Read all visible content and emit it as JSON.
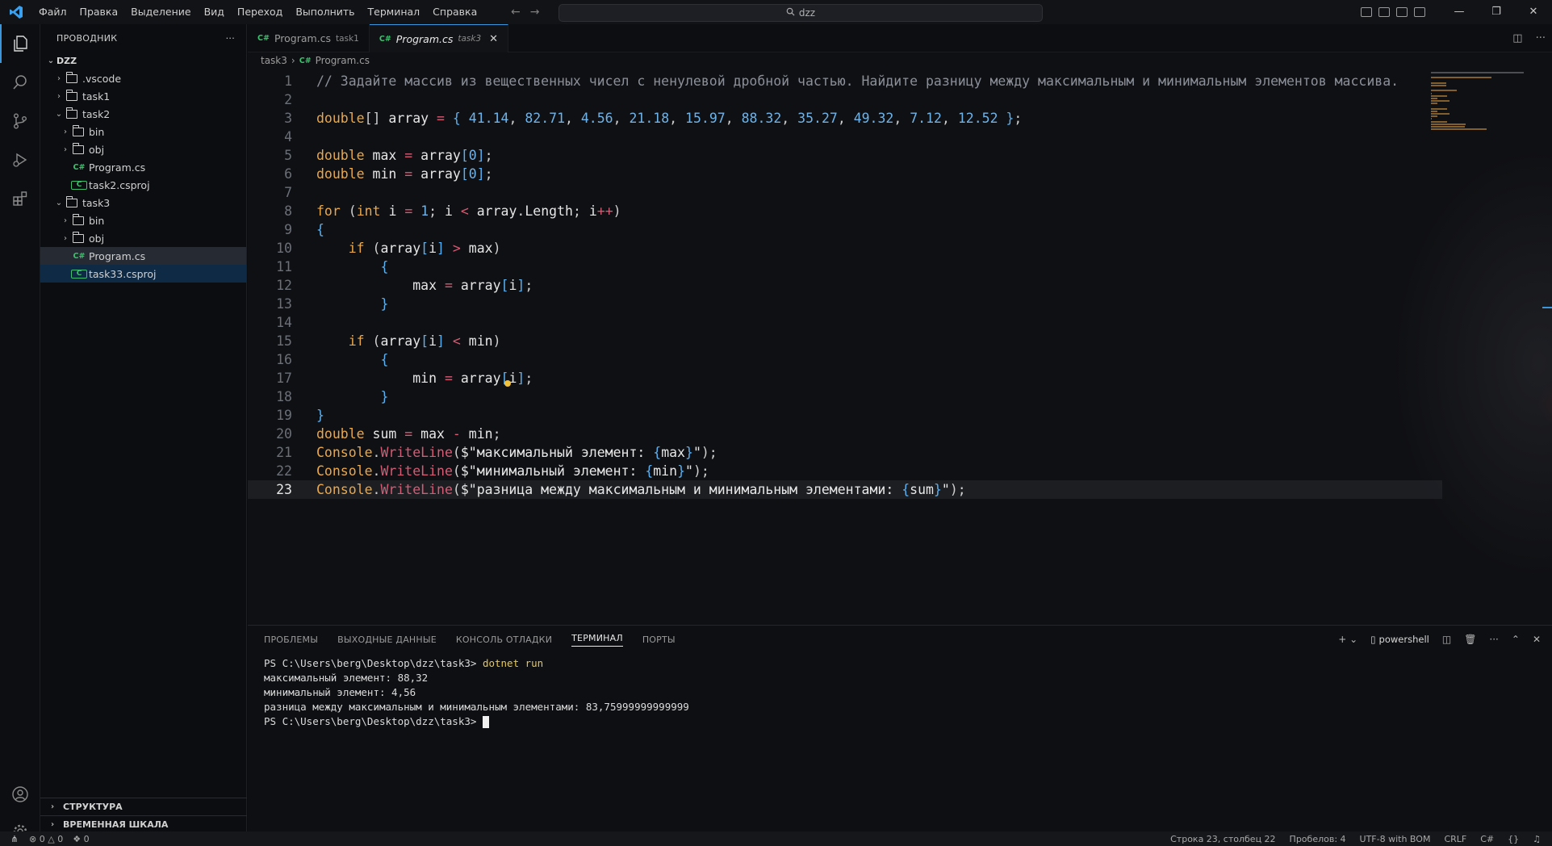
{
  "titlebar": {
    "menu": [
      "Файл",
      "Правка",
      "Выделение",
      "Вид",
      "Переход",
      "Выполнить",
      "Терминал",
      "Справка"
    ],
    "search": "dzz"
  },
  "sidebar": {
    "title": "ПРОВОДНИК",
    "more": "···",
    "workspace": "DZZ",
    "items": [
      {
        "label": ".vscode",
        "type": "folder",
        "depth": 1,
        "expanded": false
      },
      {
        "label": "task1",
        "type": "folder",
        "depth": 1,
        "expanded": false
      },
      {
        "label": "task2",
        "type": "folder",
        "depth": 1,
        "expanded": true
      },
      {
        "label": "bin",
        "type": "folder",
        "depth": 2,
        "expanded": false
      },
      {
        "label": "obj",
        "type": "folder",
        "depth": 2,
        "expanded": false
      },
      {
        "label": "Program.cs",
        "type": "cs",
        "depth": 2
      },
      {
        "label": "task2.csproj",
        "type": "proj",
        "depth": 2
      },
      {
        "label": "task3",
        "type": "folder",
        "depth": 1,
        "expanded": true
      },
      {
        "label": "bin",
        "type": "folder",
        "depth": 2,
        "expanded": false
      },
      {
        "label": "obj",
        "type": "folder",
        "depth": 2,
        "expanded": false
      },
      {
        "label": "Program.cs",
        "type": "cs",
        "depth": 2,
        "state": "selected"
      },
      {
        "label": "task33.csproj",
        "type": "proj",
        "depth": 2,
        "state": "focused"
      }
    ],
    "bottom_sections": [
      "СТРУКТУРА",
      "ВРЕМЕННАЯ ШКАЛА"
    ]
  },
  "editor": {
    "tabs": [
      {
        "label": "Program.cs",
        "sub": "task1",
        "active": false
      },
      {
        "label": "Program.cs",
        "sub": "task3",
        "active": true
      }
    ],
    "breadcrumb": [
      "task3",
      "Program.cs"
    ],
    "current_line": 23,
    "lines": [
      [
        [
          "c",
          "// Задайте массив из вещественных чисел с ненулевой дробной частью. Найдите разницу между максимальным и минимальным элементов массива."
        ]
      ],
      [],
      [
        [
          "k",
          "double"
        ],
        [
          "p",
          "[] "
        ],
        [
          "v",
          "array"
        ],
        [
          "p",
          " "
        ],
        [
          "o",
          "="
        ],
        [
          "p",
          " "
        ],
        [
          "b",
          "{"
        ],
        [
          "p",
          " "
        ],
        [
          "n",
          "41.14"
        ],
        [
          "p",
          ", "
        ],
        [
          "n",
          "82.71"
        ],
        [
          "p",
          ", "
        ],
        [
          "n",
          "4.56"
        ],
        [
          "p",
          ", "
        ],
        [
          "n",
          "21.18"
        ],
        [
          "p",
          ", "
        ],
        [
          "n",
          "15.97"
        ],
        [
          "p",
          ", "
        ],
        [
          "n",
          "88.32"
        ],
        [
          "p",
          ", "
        ],
        [
          "n",
          "35.27"
        ],
        [
          "p",
          ", "
        ],
        [
          "n",
          "49.32"
        ],
        [
          "p",
          ", "
        ],
        [
          "n",
          "7.12"
        ],
        [
          "p",
          ", "
        ],
        [
          "n",
          "12.52"
        ],
        [
          "p",
          " "
        ],
        [
          "b",
          "}"
        ],
        [
          "p",
          ";"
        ]
      ],
      [],
      [
        [
          "k",
          "double"
        ],
        [
          "p",
          " "
        ],
        [
          "v",
          "max"
        ],
        [
          "p",
          " "
        ],
        [
          "o",
          "="
        ],
        [
          "p",
          " "
        ],
        [
          "v",
          "array"
        ],
        [
          "b",
          "["
        ],
        [
          "n",
          "0"
        ],
        [
          "b",
          "]"
        ],
        [
          "p",
          ";"
        ]
      ],
      [
        [
          "k",
          "double"
        ],
        [
          "p",
          " "
        ],
        [
          "v",
          "min"
        ],
        [
          "p",
          " "
        ],
        [
          "o",
          "="
        ],
        [
          "p",
          " "
        ],
        [
          "v",
          "array"
        ],
        [
          "b",
          "["
        ],
        [
          "n",
          "0"
        ],
        [
          "b",
          "]"
        ],
        [
          "p",
          ";"
        ]
      ],
      [],
      [
        [
          "k",
          "for"
        ],
        [
          "p",
          " ("
        ],
        [
          "k",
          "int"
        ],
        [
          "p",
          " "
        ],
        [
          "v",
          "i"
        ],
        [
          "p",
          " "
        ],
        [
          "o",
          "="
        ],
        [
          "p",
          " "
        ],
        [
          "n",
          "1"
        ],
        [
          "p",
          "; "
        ],
        [
          "v",
          "i"
        ],
        [
          "p",
          " "
        ],
        [
          "o",
          "<"
        ],
        [
          "p",
          " "
        ],
        [
          "v",
          "array"
        ],
        [
          "p",
          "."
        ],
        [
          "v",
          "Length"
        ],
        [
          "p",
          "; "
        ],
        [
          "v",
          "i"
        ],
        [
          "o",
          "++"
        ],
        [
          "p",
          ")"
        ]
      ],
      [
        [
          "b",
          "{"
        ]
      ],
      [
        [
          "p",
          "    "
        ],
        [
          "k",
          "if"
        ],
        [
          "p",
          " ("
        ],
        [
          "v",
          "array"
        ],
        [
          "b",
          "["
        ],
        [
          "v",
          "i"
        ],
        [
          "b",
          "]"
        ],
        [
          "p",
          " "
        ],
        [
          "o",
          ">"
        ],
        [
          "p",
          " "
        ],
        [
          "v",
          "max"
        ],
        [
          "p",
          ")"
        ]
      ],
      [
        [
          "p",
          "        "
        ],
        [
          "b",
          "{"
        ]
      ],
      [
        [
          "p",
          "            "
        ],
        [
          "v",
          "max"
        ],
        [
          "p",
          " "
        ],
        [
          "o",
          "="
        ],
        [
          "p",
          " "
        ],
        [
          "v",
          "array"
        ],
        [
          "b",
          "["
        ],
        [
          "v",
          "i"
        ],
        [
          "b",
          "]"
        ],
        [
          "p",
          ";"
        ]
      ],
      [
        [
          "p",
          "        "
        ],
        [
          "b",
          "}"
        ]
      ],
      [],
      [
        [
          "p",
          "    "
        ],
        [
          "k",
          "if"
        ],
        [
          "p",
          " ("
        ],
        [
          "v",
          "array"
        ],
        [
          "b",
          "["
        ],
        [
          "v",
          "i"
        ],
        [
          "b",
          "]"
        ],
        [
          "p",
          " "
        ],
        [
          "o",
          "<"
        ],
        [
          "p",
          " "
        ],
        [
          "v",
          "min"
        ],
        [
          "p",
          ")"
        ]
      ],
      [
        [
          "p",
          "        "
        ],
        [
          "b",
          "{"
        ]
      ],
      [
        [
          "p",
          "            "
        ],
        [
          "v",
          "min"
        ],
        [
          "p",
          " "
        ],
        [
          "o",
          "="
        ],
        [
          "p",
          " "
        ],
        [
          "v",
          "array"
        ],
        [
          "b",
          "["
        ],
        [
          "v",
          "i"
        ],
        [
          "b",
          "]"
        ],
        [
          "p",
          ";"
        ]
      ],
      [
        [
          "p",
          "        "
        ],
        [
          "b",
          "}"
        ]
      ],
      [
        [
          "b",
          "}"
        ]
      ],
      [
        [
          "k",
          "double"
        ],
        [
          "p",
          " "
        ],
        [
          "v",
          "sum"
        ],
        [
          "p",
          " "
        ],
        [
          "o",
          "="
        ],
        [
          "p",
          " "
        ],
        [
          "v",
          "max"
        ],
        [
          "p",
          " "
        ],
        [
          "o",
          "-"
        ],
        [
          "p",
          " "
        ],
        [
          "v",
          "min"
        ],
        [
          "p",
          ";"
        ]
      ],
      [
        [
          "k",
          "Console"
        ],
        [
          "p",
          "."
        ],
        [
          "m",
          "WriteLine"
        ],
        [
          "p",
          "("
        ],
        [
          "s",
          "$\"максимальный элемент: "
        ],
        [
          "b",
          "{"
        ],
        [
          "v",
          "max"
        ],
        [
          "b",
          "}"
        ],
        [
          "s",
          "\""
        ],
        [
          "p",
          ");"
        ]
      ],
      [
        [
          "k",
          "Console"
        ],
        [
          "p",
          "."
        ],
        [
          "m",
          "WriteLine"
        ],
        [
          "p",
          "("
        ],
        [
          "s",
          "$\"минимальный элемент: "
        ],
        [
          "b",
          "{"
        ],
        [
          "v",
          "min"
        ],
        [
          "b",
          "}"
        ],
        [
          "s",
          "\""
        ],
        [
          "p",
          ");"
        ]
      ],
      [
        [
          "k",
          "Console"
        ],
        [
          "p",
          "."
        ],
        [
          "m",
          "WriteLine"
        ],
        [
          "p",
          "("
        ],
        [
          "s",
          "$\"разница между максимальным и минимальным элементами: "
        ],
        [
          "b",
          "{"
        ],
        [
          "v",
          "sum"
        ],
        [
          "b",
          "}"
        ],
        [
          "s",
          "\""
        ],
        [
          "p",
          ");"
        ]
      ]
    ]
  },
  "panel": {
    "tabs": [
      "ПРОБЛЕМЫ",
      "ВЫХОДНЫЕ ДАННЫЕ",
      "КОНСОЛЬ ОТЛАДКИ",
      "ТЕРМИНАЛ",
      "ПОРТЫ"
    ],
    "active_tab": "ТЕРМИНАЛ",
    "shell": "powershell",
    "terminal": {
      "prompt": "PS C:\\Users\\berg\\Desktop\\dzz\\task3> ",
      "command": "dotnet run",
      "output": [
        "максимальный элемент: 88,32",
        "минимальный элемент: 4,56",
        "разница между максимальным и минимальным элементами: 83,75999999999999"
      ]
    }
  },
  "statusbar": {
    "errors": "0",
    "warnings": "0",
    "ports": "0",
    "position": "Строка 23, столбец 22",
    "spaces": "Пробелов: 4",
    "encoding": "UTF-8 with BOM",
    "eol": "CRLF",
    "language": "C#"
  },
  "colors": {
    "accent": "#3a96dd",
    "keyword": "#e9a84a",
    "number": "#6fb3e8",
    "csharp_icon": "#3fbf6f"
  }
}
